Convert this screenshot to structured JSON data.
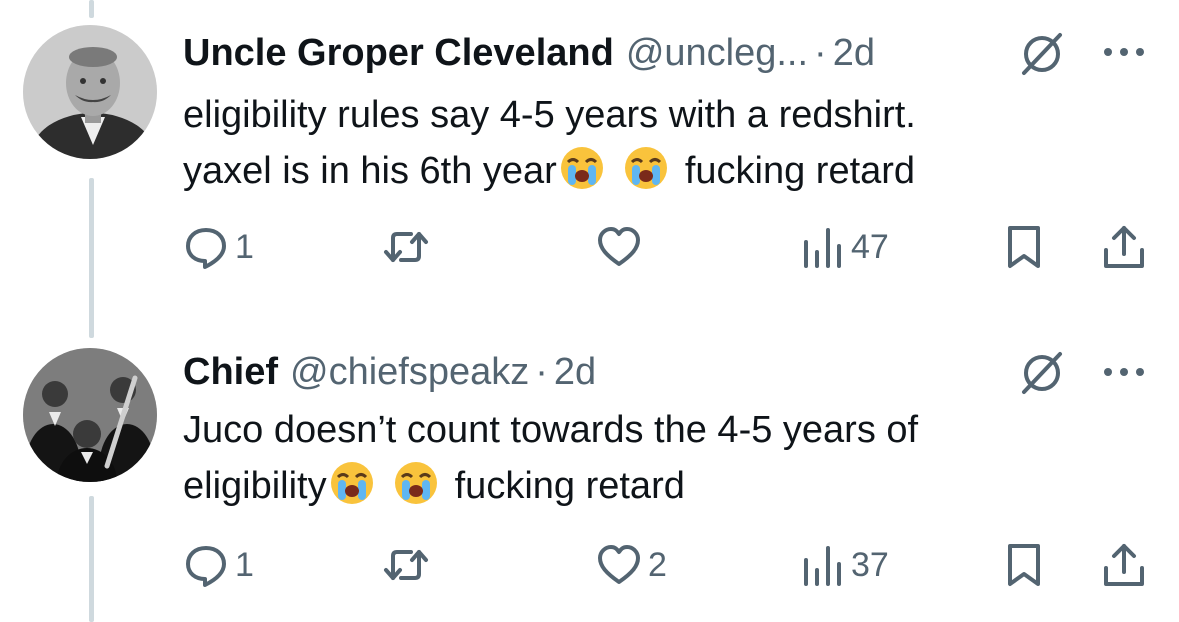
{
  "tweets": [
    {
      "name": "Uncle Groper Cleveland",
      "handle": "@uncleg...",
      "separator": "·",
      "time": "2d",
      "line1": "eligibility rules say 4-5 years with a redshirt.",
      "line2_before": "yaxel is in his 6th year",
      "line2_after": "fucking retard",
      "emoji": "loudly-crying-face",
      "replies": "1",
      "reposts": "",
      "likes": "",
      "views": "47"
    },
    {
      "name": "Chief",
      "handle": "@chiefspeakz",
      "separator": "·",
      "time": "2d",
      "line1": "Juco doesn’t count towards the 4-5 years of",
      "line2_before": "eligibility",
      "line2_after": "fucking retard",
      "emoji": "loudly-crying-face",
      "replies": "1",
      "reposts": "",
      "likes": "2",
      "views": "37"
    }
  ],
  "colors": {
    "text": "#0f1419",
    "muted": "#536471",
    "thread": "#cfd9de"
  },
  "icons": [
    "grok-icon",
    "more-icon",
    "reply-icon",
    "repost-icon",
    "like-icon",
    "views-icon",
    "bookmark-icon",
    "share-icon"
  ]
}
